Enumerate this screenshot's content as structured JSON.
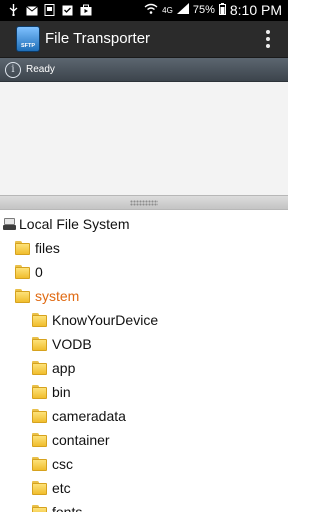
{
  "status_bar": {
    "icons": [
      "usb-icon",
      "mail-icon",
      "screenshot-icon",
      "task-icon",
      "bag-icon",
      "wifi-icon",
      "lte-icon",
      "signal-icon",
      "battery-icon"
    ],
    "network": "4G",
    "battery_percent": "75%",
    "time": "8:10 PM"
  },
  "action_bar": {
    "app_icon_text": "SFTP",
    "title": "File Transporter"
  },
  "info_bar": {
    "status": "Ready"
  },
  "tree": {
    "root_label": "Local File System",
    "items": [
      {
        "label": "files"
      },
      {
        "label": "0"
      },
      {
        "label": "system",
        "selected": true
      },
      {
        "label": "KnowYourDevice"
      },
      {
        "label": "VODB"
      },
      {
        "label": "app"
      },
      {
        "label": "bin"
      },
      {
        "label": "cameradata"
      },
      {
        "label": "container"
      },
      {
        "label": "csc"
      },
      {
        "label": "etc"
      },
      {
        "label": "fonts"
      }
    ]
  }
}
